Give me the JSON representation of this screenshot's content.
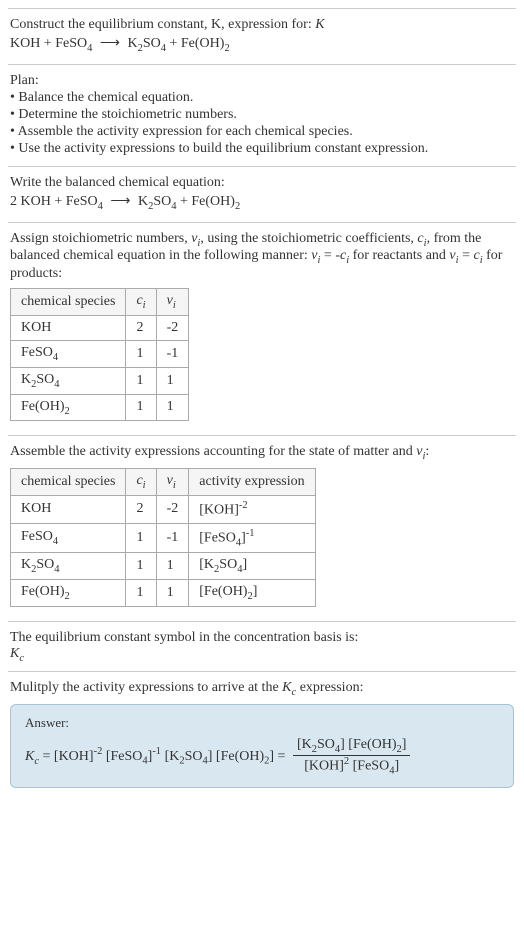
{
  "header": {
    "line1": "Construct the equilibrium constant, K, expression for:",
    "equation_text": "KOH + FeSO4 ⟶ K2SO4 + Fe(OH)2"
  },
  "plan": {
    "title": "Plan:",
    "items": [
      "• Balance the chemical equation.",
      "• Determine the stoichiometric numbers.",
      "• Assemble the activity expression for each chemical species.",
      "• Use the activity expressions to build the equilibrium constant expression."
    ]
  },
  "balanced": {
    "title": "Write the balanced chemical equation:",
    "equation_text": "2 KOH + FeSO4 ⟶ K2SO4 + Fe(OH)2"
  },
  "stoich": {
    "intro_a": "Assign stoichiometric numbers, ",
    "intro_b": ", using the stoichiometric coefficients, ",
    "intro_c": ", from the balanced chemical equation in the following manner: ",
    "intro_d": " for reactants and ",
    "intro_e": " for products:",
    "headers": [
      "chemical species",
      "c_i",
      "ν_i"
    ],
    "rows": [
      {
        "species": "KOH",
        "c": "2",
        "nu": "-2"
      },
      {
        "species": "FeSO4",
        "c": "1",
        "nu": "-1"
      },
      {
        "species": "K2SO4",
        "c": "1",
        "nu": "1"
      },
      {
        "species": "Fe(OH)2",
        "c": "1",
        "nu": "1"
      }
    ]
  },
  "activity": {
    "intro": "Assemble the activity expressions accounting for the state of matter and ",
    "intro_suffix": ":",
    "headers": [
      "chemical species",
      "c_i",
      "ν_i",
      "activity expression"
    ],
    "rows": [
      {
        "species": "KOH",
        "c": "2",
        "nu": "-2",
        "expr_base": "[KOH]",
        "expr_exp": "-2"
      },
      {
        "species": "FeSO4",
        "c": "1",
        "nu": "-1",
        "expr_base": "[FeSO4]",
        "expr_exp": "-1"
      },
      {
        "species": "K2SO4",
        "c": "1",
        "nu": "1",
        "expr_base": "[K2SO4]",
        "expr_exp": ""
      },
      {
        "species": "Fe(OH)2",
        "c": "1",
        "nu": "1",
        "expr_base": "[Fe(OH)2]",
        "expr_exp": ""
      }
    ]
  },
  "symbol": {
    "line1": "The equilibrium constant symbol in the concentration basis is:",
    "line2": "K_c"
  },
  "multiply": {
    "text": "Mulitply the activity expressions to arrive at the ",
    "text_suffix": " expression:"
  },
  "answer": {
    "label": "Answer:"
  },
  "chart_data": {
    "type": "table",
    "tables": [
      {
        "title": "stoichiometric numbers",
        "columns": [
          "chemical species",
          "c_i",
          "ν_i"
        ],
        "rows": [
          [
            "KOH",
            2,
            -2
          ],
          [
            "FeSO4",
            1,
            -1
          ],
          [
            "K2SO4",
            1,
            1
          ],
          [
            "Fe(OH)2",
            1,
            1
          ]
        ]
      },
      {
        "title": "activity expressions",
        "columns": [
          "chemical species",
          "c_i",
          "ν_i",
          "activity expression"
        ],
        "rows": [
          [
            "KOH",
            2,
            -2,
            "[KOH]^-2"
          ],
          [
            "FeSO4",
            1,
            -1,
            "[FeSO4]^-1"
          ],
          [
            "K2SO4",
            1,
            1,
            "[K2SO4]"
          ],
          [
            "Fe(OH)2",
            1,
            1,
            "[Fe(OH)2]"
          ]
        ]
      }
    ],
    "equilibrium_expression": "K_c = [KOH]^-2 [FeSO4]^-1 [K2SO4] [Fe(OH)2] = ([K2SO4][Fe(OH)2]) / ([KOH]^2 [FeSO4])"
  }
}
